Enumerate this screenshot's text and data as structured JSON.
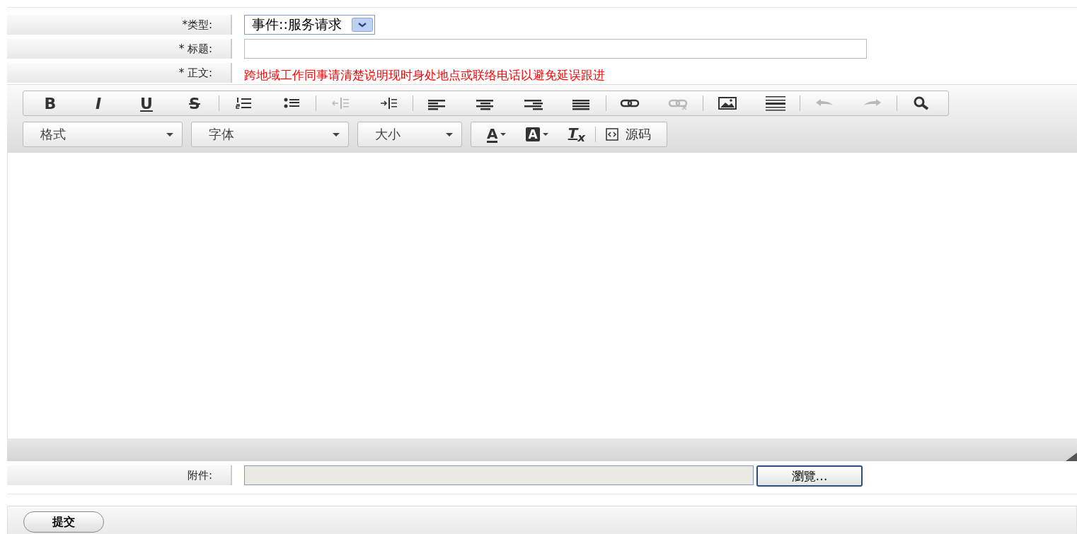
{
  "form": {
    "rows": [
      {
        "label": "*类型:",
        "kind": "select",
        "value": "事件::服务请求"
      },
      {
        "label": "* 标题:",
        "kind": "text"
      },
      {
        "label": "* 正文:",
        "kind": "note",
        "note": "跨地域工作同事请清楚说明现时身处地点或联络电话以避免延误跟进"
      }
    ]
  },
  "editor": {
    "toolbar": [
      [
        {
          "kind": "bold",
          "label": "B",
          "disabled": false
        },
        {
          "kind": "italic",
          "label": "I",
          "disabled": false
        },
        {
          "kind": "underline",
          "label": "U",
          "disabled": false
        },
        {
          "kind": "strike",
          "label": "S",
          "disabled": false
        }
      ],
      [
        {
          "kind": "numbered-list",
          "disabled": false
        },
        {
          "kind": "bulleted-list",
          "disabled": false
        }
      ],
      [
        {
          "kind": "outdent",
          "disabled": true
        },
        {
          "kind": "indent",
          "disabled": false
        }
      ],
      [
        {
          "kind": "align-left",
          "disabled": false
        },
        {
          "kind": "align-center",
          "disabled": false
        },
        {
          "kind": "align-right",
          "disabled": false
        },
        {
          "kind": "justify",
          "disabled": false
        }
      ],
      [
        {
          "kind": "link",
          "disabled": false
        },
        {
          "kind": "unlink",
          "disabled": true
        }
      ],
      [
        {
          "kind": "image",
          "disabled": false
        },
        {
          "kind": "horizontal-rule",
          "disabled": false
        }
      ],
      [
        {
          "kind": "undo",
          "disabled": true
        },
        {
          "kind": "redo",
          "disabled": true
        }
      ],
      [
        {
          "kind": "search",
          "disabled": false
        }
      ]
    ],
    "combos": [
      {
        "label": "格式"
      },
      {
        "label": "字体"
      },
      {
        "label": "大小"
      }
    ],
    "format_buttons": [
      {
        "kind": "text-color",
        "label": "A"
      },
      {
        "kind": "background-color",
        "label": "A"
      },
      {
        "kind": "remove-format",
        "label": "T$_{x}$"
      }
    ],
    "source_button": {
      "label": "源码"
    }
  },
  "attachment": {
    "label": "附件:",
    "browse": "瀏覽…"
  },
  "submit": "提交"
}
